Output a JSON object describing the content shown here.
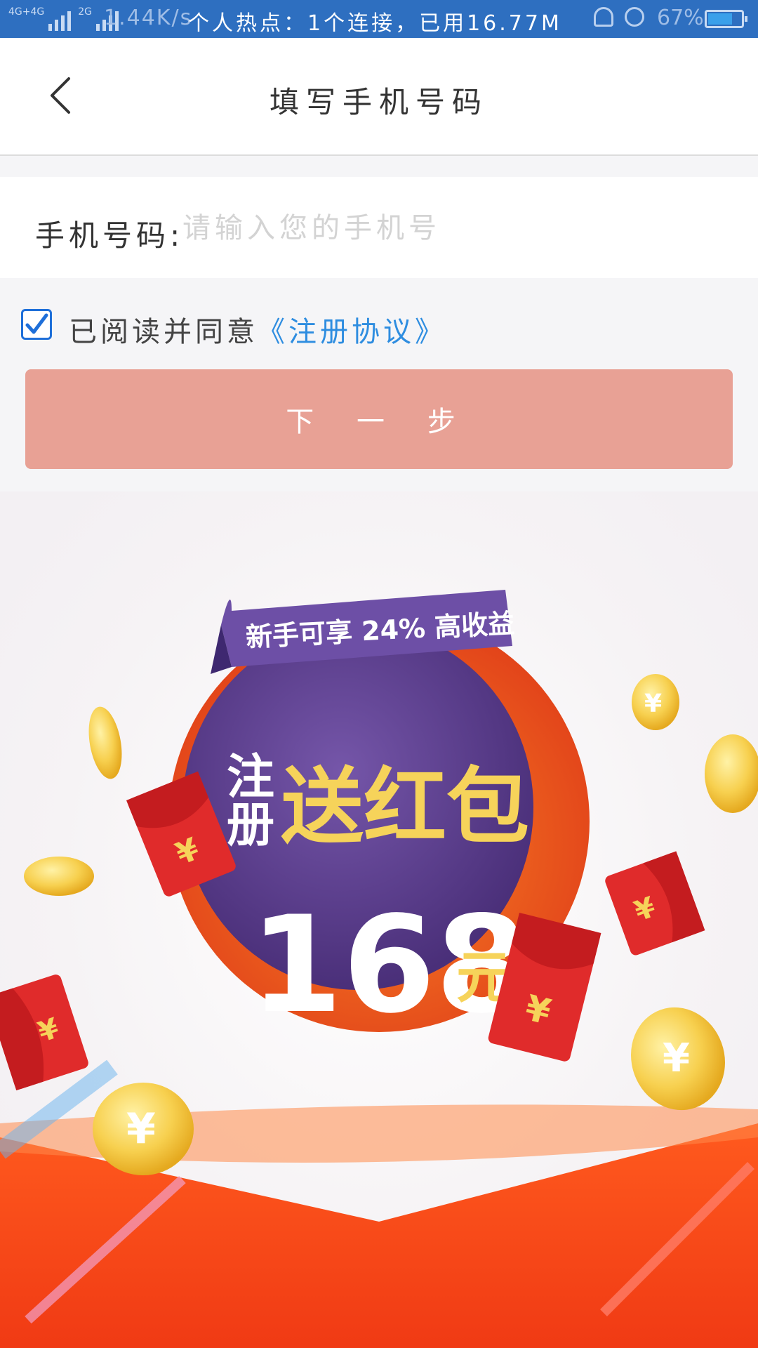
{
  "status_bar": {
    "network": "4G+4G",
    "network2": "2G",
    "speed": "1.44K/s",
    "hotspot": "个人热点：1个连接，已用16.77M",
    "battery": "67%"
  },
  "header": {
    "title": "填写手机号码"
  },
  "form": {
    "phone_label": "手机号码:",
    "phone_placeholder": "请输入您的手机号",
    "agree_text": "已阅读并同意",
    "agree_link": "《注册协议》",
    "next_label": "下 一 步"
  },
  "banner": {
    "ribbon_text": "新手可享 24% 高收益",
    "side_text": "注册",
    "main_text": "送红包",
    "amount": "168",
    "unit": "元",
    "coin_symbol": "¥"
  },
  "colors": {
    "status_bar": "#2e6fc0",
    "button": "#e8a195",
    "link": "#2e8de0",
    "checkbox": "#1e6fd9",
    "badge_purple": "#5b3f8c",
    "gold": "#f3c64c",
    "red": "#e02b2b"
  }
}
